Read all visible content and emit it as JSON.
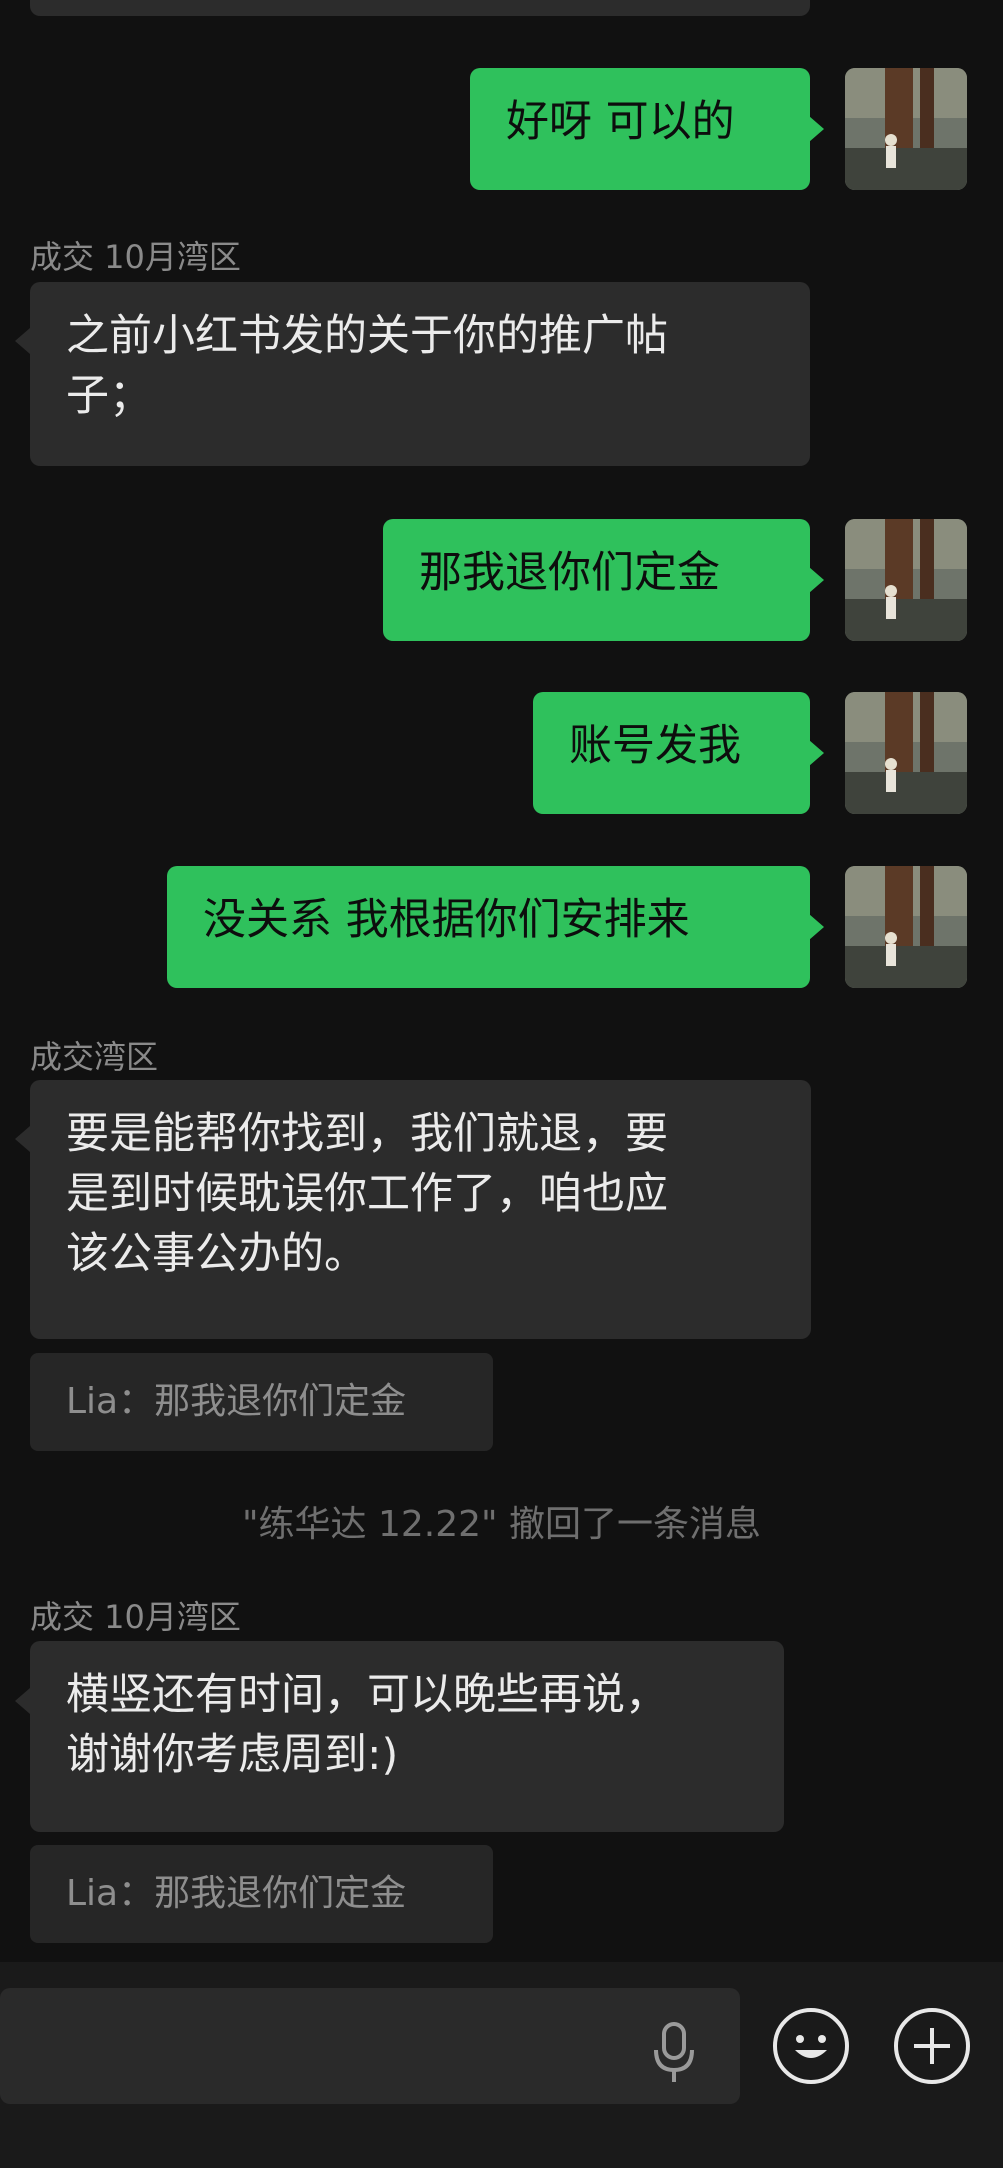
{
  "messages": {
    "m1": {
      "text": "好呀 可以的"
    },
    "m2": {
      "sender": "成交 10月湾区",
      "text": "之前小红书发的关于你的推广帖\n子；"
    },
    "m3": {
      "text": "那我退你们定金"
    },
    "m4": {
      "text": "账号发我"
    },
    "m5": {
      "text": "没关系 我根据你们安排来"
    },
    "m6": {
      "sender": "成交湾区",
      "text": "要是能帮你找到，我们就退，要\n是到时候耽误你工作了，咱也应\n该公事公办的。",
      "quote": "Lia：那我退你们定金"
    },
    "system": "\"练华达 12.22\" 撤回了一条消息",
    "m7": {
      "sender": "成交 10月湾区",
      "text": "横竖还有时间，可以晚些再说，\n谢谢你考虑周到:)",
      "quote": "Lia：那我退你们定金"
    }
  },
  "input": {
    "placeholder": ""
  },
  "icons": {
    "voice": "microphone-icon",
    "emoji": "emoji-icon",
    "more": "plus-icon"
  },
  "colors": {
    "outgoing_bubble": "#2fc15c",
    "incoming_bubble": "#2c2c2c",
    "background": "#111111"
  }
}
